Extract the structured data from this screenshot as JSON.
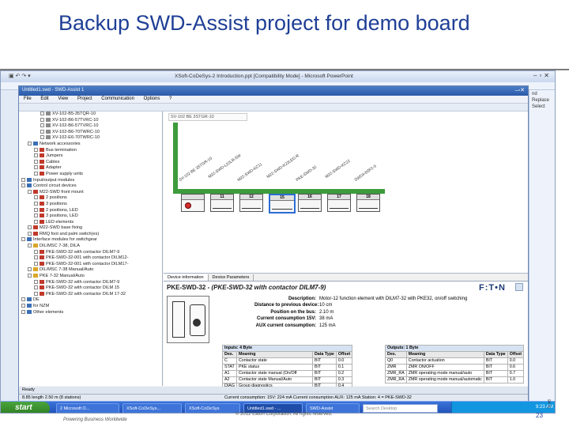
{
  "slide": {
    "title": "Backup SWD-Assist project for demo board",
    "footer_left": "Powering Business Worldwide",
    "footer_center": "© 2012 Eaton Corporation. All rights reserved.",
    "page_number": "23"
  },
  "powerpoint": {
    "window_title": "XSoft-CoDeSys-2 Introduction.ppt [Compatibility Mode] - Microsoft PowerPoint",
    "right_pane": [
      "nd",
      "Replace",
      "Select"
    ],
    "status_vertical": "94 %"
  },
  "swd": {
    "window_title": "Untitled1.swd - SWD-Assist 1",
    "menu": [
      "File",
      "Edit",
      "View",
      "Project",
      "Communication",
      "Options",
      "?"
    ],
    "ready": "Ready",
    "status_left": "8 x 3",
    "status_bus": "Current consumption: 15V: 224 mA   Current consumption AUX: 125 mA  Station: 4 = PKE-SWD-32",
    "status_len": "8.85 length 2.50 m (8 stations)",
    "canvas_label": "SV-102 BE 3STGR-10"
  },
  "tree": [
    {
      "label": "XV-102-B5-35TQR-10",
      "indent": 3,
      "icon": "gr"
    },
    {
      "label": "XV-102-B6-57TVRC-10",
      "indent": 3,
      "icon": "gr"
    },
    {
      "label": "XV-102-B6-57TVRC-10",
      "indent": 3,
      "icon": "gr"
    },
    {
      "label": "XV-102-B6-70TWRC-10",
      "indent": 3,
      "icon": "gr"
    },
    {
      "label": "XV-102-E6-70TWRC-10",
      "indent": 3,
      "icon": "gr"
    },
    {
      "label": "Network accessories",
      "indent": 1,
      "icon": "b"
    },
    {
      "label": "Bus termination",
      "indent": 2,
      "icon": "r"
    },
    {
      "label": "Jumpers",
      "indent": 2,
      "icon": "r"
    },
    {
      "label": "Cables",
      "indent": 2,
      "icon": "r"
    },
    {
      "label": "Adapter",
      "indent": 2,
      "icon": "r"
    },
    {
      "label": "Power supply units",
      "indent": 2,
      "icon": "r"
    },
    {
      "label": "Input/output modules",
      "indent": 0,
      "icon": "b"
    },
    {
      "label": "Control circuit devices",
      "indent": 0,
      "icon": "b"
    },
    {
      "label": "M22-SWD front mount",
      "indent": 1,
      "icon": "r"
    },
    {
      "label": "2 positions",
      "indent": 2,
      "icon": "r"
    },
    {
      "label": "3 positions",
      "indent": 2,
      "icon": "r"
    },
    {
      "label": "2 positions, LED",
      "indent": 2,
      "icon": "r"
    },
    {
      "label": "3 positions, LED",
      "indent": 2,
      "icon": "r"
    },
    {
      "label": "LED elements",
      "indent": 2,
      "icon": "r"
    },
    {
      "label": "M22-SWD base fixing",
      "indent": 1,
      "icon": "r"
    },
    {
      "label": "RMQ foot and palm switch(es)",
      "indent": 1,
      "icon": "r"
    },
    {
      "label": "Interface modules for switchgear",
      "indent": 0,
      "icon": "b"
    },
    {
      "label": "DIL/MSC 7-38, DILA",
      "indent": 1,
      "icon": "y"
    },
    {
      "label": "PKE-SWD-32 with contactor DILM7-9",
      "indent": 2,
      "icon": "r"
    },
    {
      "label": "PKE-SWD-32-001 with contactor DILM12-",
      "indent": 2,
      "icon": "r"
    },
    {
      "label": "PKE-SWD-32-001 with contactor DILM17-",
      "indent": 2,
      "icon": "r"
    },
    {
      "label": "DIL/MSC 7-38 Manual/Auto",
      "indent": 1,
      "icon": "y"
    },
    {
      "label": "PKE 7-32 Manual/Auto",
      "indent": 1,
      "icon": "y"
    },
    {
      "label": "PKE-SWD-32 with contactor DILM7-9",
      "indent": 2,
      "icon": "r"
    },
    {
      "label": "PKE-SWD-32 with contactor DILM 15",
      "indent": 2,
      "icon": "r"
    },
    {
      "label": "PKE-SWD-32 with contactor DILM 17-32",
      "indent": 2,
      "icon": "r"
    },
    {
      "label": "DE",
      "indent": 0,
      "icon": "b"
    },
    {
      "label": "for NZM",
      "indent": 0,
      "icon": "b"
    },
    {
      "label": "Other elements",
      "indent": 0,
      "icon": "b"
    }
  ],
  "chain": {
    "labels": [
      "SV-102 BE 3STGR-10",
      "M22-SWD-L22LR-SW",
      "M22-SWD-KC11",
      "M22-SWD-K22LED-R",
      "PKE-SWD-32",
      "M22-SWD-KC22",
      "SWD4-8SF2-5"
    ],
    "devices": [
      {
        "num": "",
        "type": "lamp"
      },
      {
        "num": "11",
        "type": "switch"
      },
      {
        "num": "12",
        "type": "switch"
      },
      {
        "num": "15",
        "type": "pke"
      },
      {
        "num": "16",
        "type": "switch"
      },
      {
        "num": "17",
        "type": "switch"
      },
      {
        "num": "18",
        "type": "term"
      }
    ]
  },
  "props": {
    "tabs": [
      "Device information",
      "Device Parameters"
    ],
    "name": "PKE-SWD-32",
    "name_full": " - (PKE-SWD-32 with contactor DILM7-9)",
    "brand": "F:T•N",
    "rows": [
      {
        "k": "Description:",
        "v": "Motor-12 function element with DILM7-32 with PKE32, on/off switching"
      },
      {
        "k": "Distance to previous device:",
        "v": "10 cm"
      },
      {
        "k": "Position on the bus:",
        "v": "2.10 m"
      },
      {
        "k": "Current consumption 15V:",
        "v": "38 mA"
      },
      {
        "k": "AUX current consumption:",
        "v": "125 mA"
      }
    ],
    "inputs_title": "Inputs: 4 Byte",
    "inputs_cols": [
      "Des.",
      "Meaning",
      "Data Type",
      "Offset"
    ],
    "inputs": [
      [
        "C",
        "Contactor state",
        "BIT",
        "0.0"
      ],
      [
        "STAT",
        "PKE status",
        "BIT",
        "0.1"
      ],
      [
        "A1",
        "Contactor state manual (On/Off",
        "BIT",
        "0.2"
      ],
      [
        "A2",
        "Contactor state Manual/Auto",
        "BIT",
        "0.3"
      ],
      [
        "DIAG",
        "Group diagnostics",
        "BIT",
        "0.4"
      ]
    ],
    "outputs_title": "Outputs: 1 Byte",
    "outputs_cols": [
      "Des.",
      "Meaning",
      "Data Type",
      "Offset"
    ],
    "outputs": [
      [
        "Q0",
        "Contactor actuation",
        "BIT",
        "0.0"
      ],
      [
        "ZMR",
        "ZMR ON/OFF",
        "BIT",
        "0.6"
      ],
      [
        "ZMR_RA",
        "ZMR operating mode manual/auto",
        "BIT",
        "0.7"
      ],
      [
        "ZMR_RA",
        "ZMR operating mode manual/automatic",
        "BIT",
        "1.0"
      ]
    ]
  },
  "taskbar": {
    "start": "start",
    "buttons": [
      "2 Microsoft O...",
      "XSoft-CoDeSys...",
      "XSoft-CoDeSys",
      "Untitled1.swd - ...",
      "SWD-Assist"
    ],
    "search": "Search Desktop",
    "clock": "9:23 AM"
  }
}
